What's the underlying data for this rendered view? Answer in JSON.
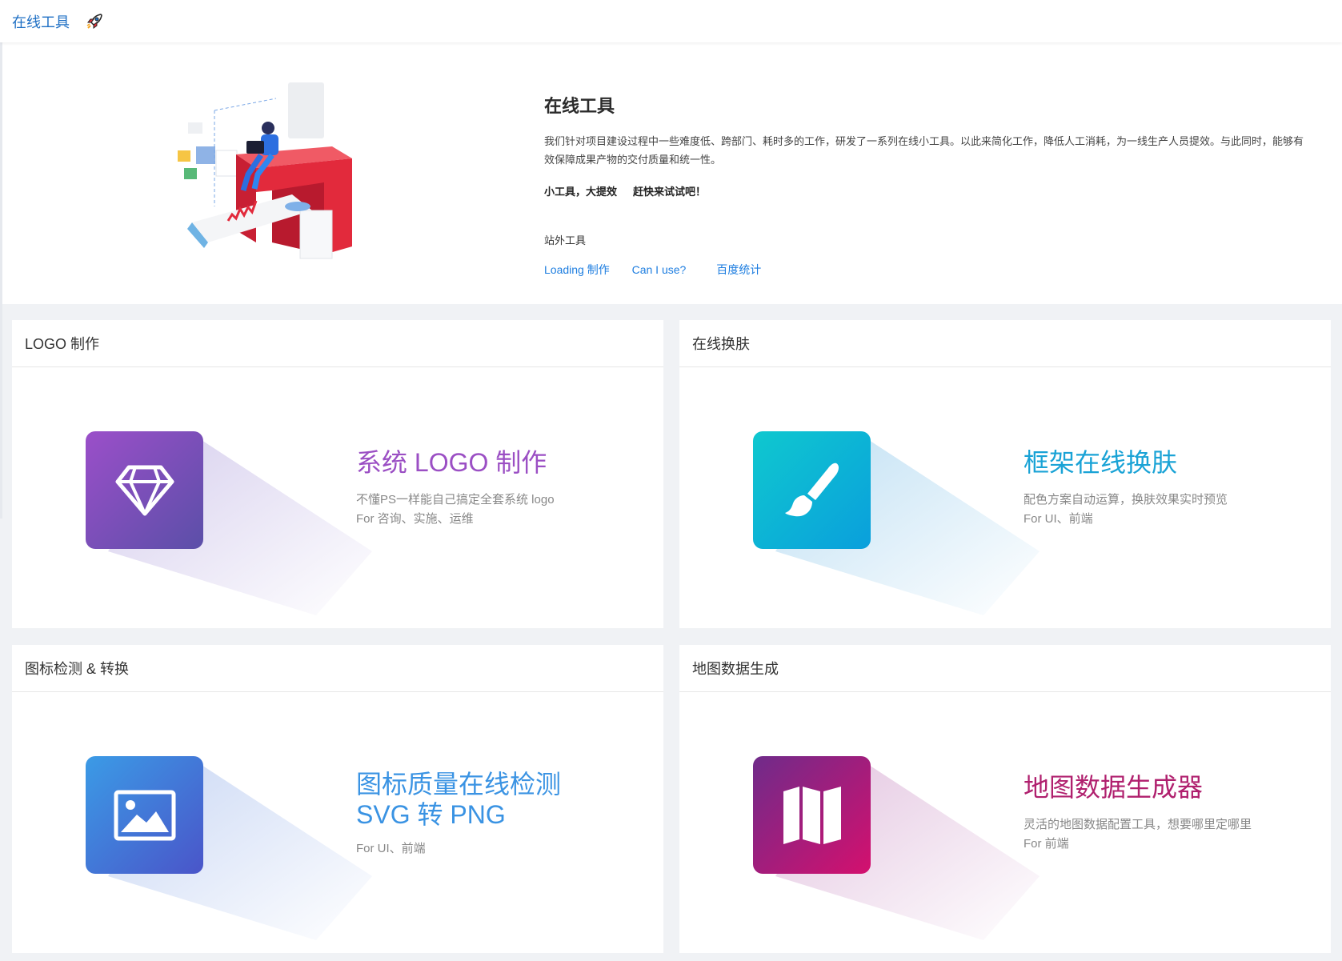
{
  "header": {
    "title": "在线工具",
    "rocket_icon": "rocket-icon"
  },
  "intro": {
    "title": "在线工具",
    "description": "我们针对项目建设过程中一些难度低、跨部门、耗时多的工作，研发了一系列在线小工具。以此来简化工作，降低人工消耗，为一线生产人员提效。与此同时，能够有效保障成果产物的交付质量和统一性。",
    "slogan_1": "小工具，大提效",
    "slogan_2": "赶快来试试吧！",
    "external_label": "站外工具",
    "external_links": [
      "Loading 制作",
      "Can I use?",
      "百度统计"
    ]
  },
  "cards": [
    {
      "header": "LOGO 制作",
      "title_line1": "系统 LOGO 制作",
      "title_line2": "",
      "sub_line1": "不懂PS一样能自己搞定全套系统 logo",
      "sub_line2": "For 咨询、实施、运维",
      "icon": "diamond-icon",
      "color": "#9b4fc4"
    },
    {
      "header": "在线换肤",
      "title_line1": "框架在线换肤",
      "title_line2": "",
      "sub_line1": "配色方案自动运算，换肤效果实时预览",
      "sub_line2": "For UI、前端",
      "icon": "paintbrush-icon",
      "color": "#1aa3d6"
    },
    {
      "header": "图标检测 & 转换",
      "title_line1": "图标质量在线检测",
      "title_line2": "SVG 转 PNG",
      "sub_line1": "For UI、前端",
      "sub_line2": "",
      "icon": "image-icon",
      "color": "#3d8ee0"
    },
    {
      "header": "地图数据生成",
      "title_line1": "地图数据生成器",
      "title_line2": "",
      "sub_line1": "灵活的地图数据配置工具，想要哪里定哪里",
      "sub_line2": "For 前端",
      "icon": "map-icon",
      "color": "#b0206e"
    }
  ]
}
